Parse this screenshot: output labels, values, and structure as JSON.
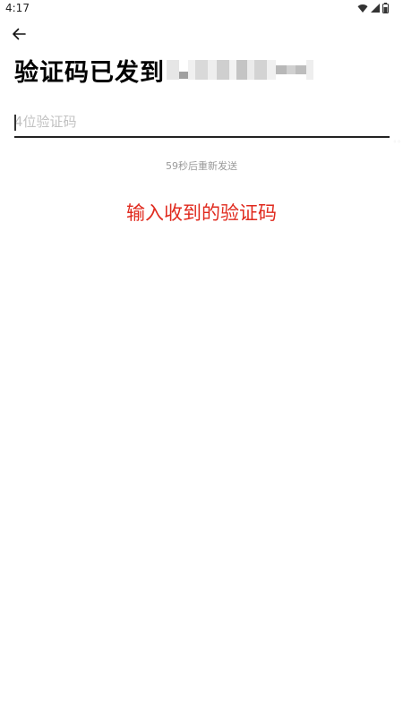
{
  "status_bar": {
    "time": "4:17",
    "icons": [
      "wifi-icon",
      "cell-signal-icon",
      "battery-icon"
    ]
  },
  "header": {
    "back_icon": "arrow-left-icon",
    "title": "验证码已发到",
    "phone_masked": true
  },
  "code_input": {
    "placeholder": "4位验证码",
    "value": ""
  },
  "resend": {
    "text": "59秒后重新发送"
  },
  "instruction": {
    "text": "输入收到的验证码",
    "color": "#e02a1e"
  },
  "colors": {
    "background": "#ffffff",
    "title": "#000000",
    "underline": "#222222",
    "placeholder": "#c2c2c2",
    "resend": "#9a9a9a",
    "accent_red": "#e02a1e"
  }
}
